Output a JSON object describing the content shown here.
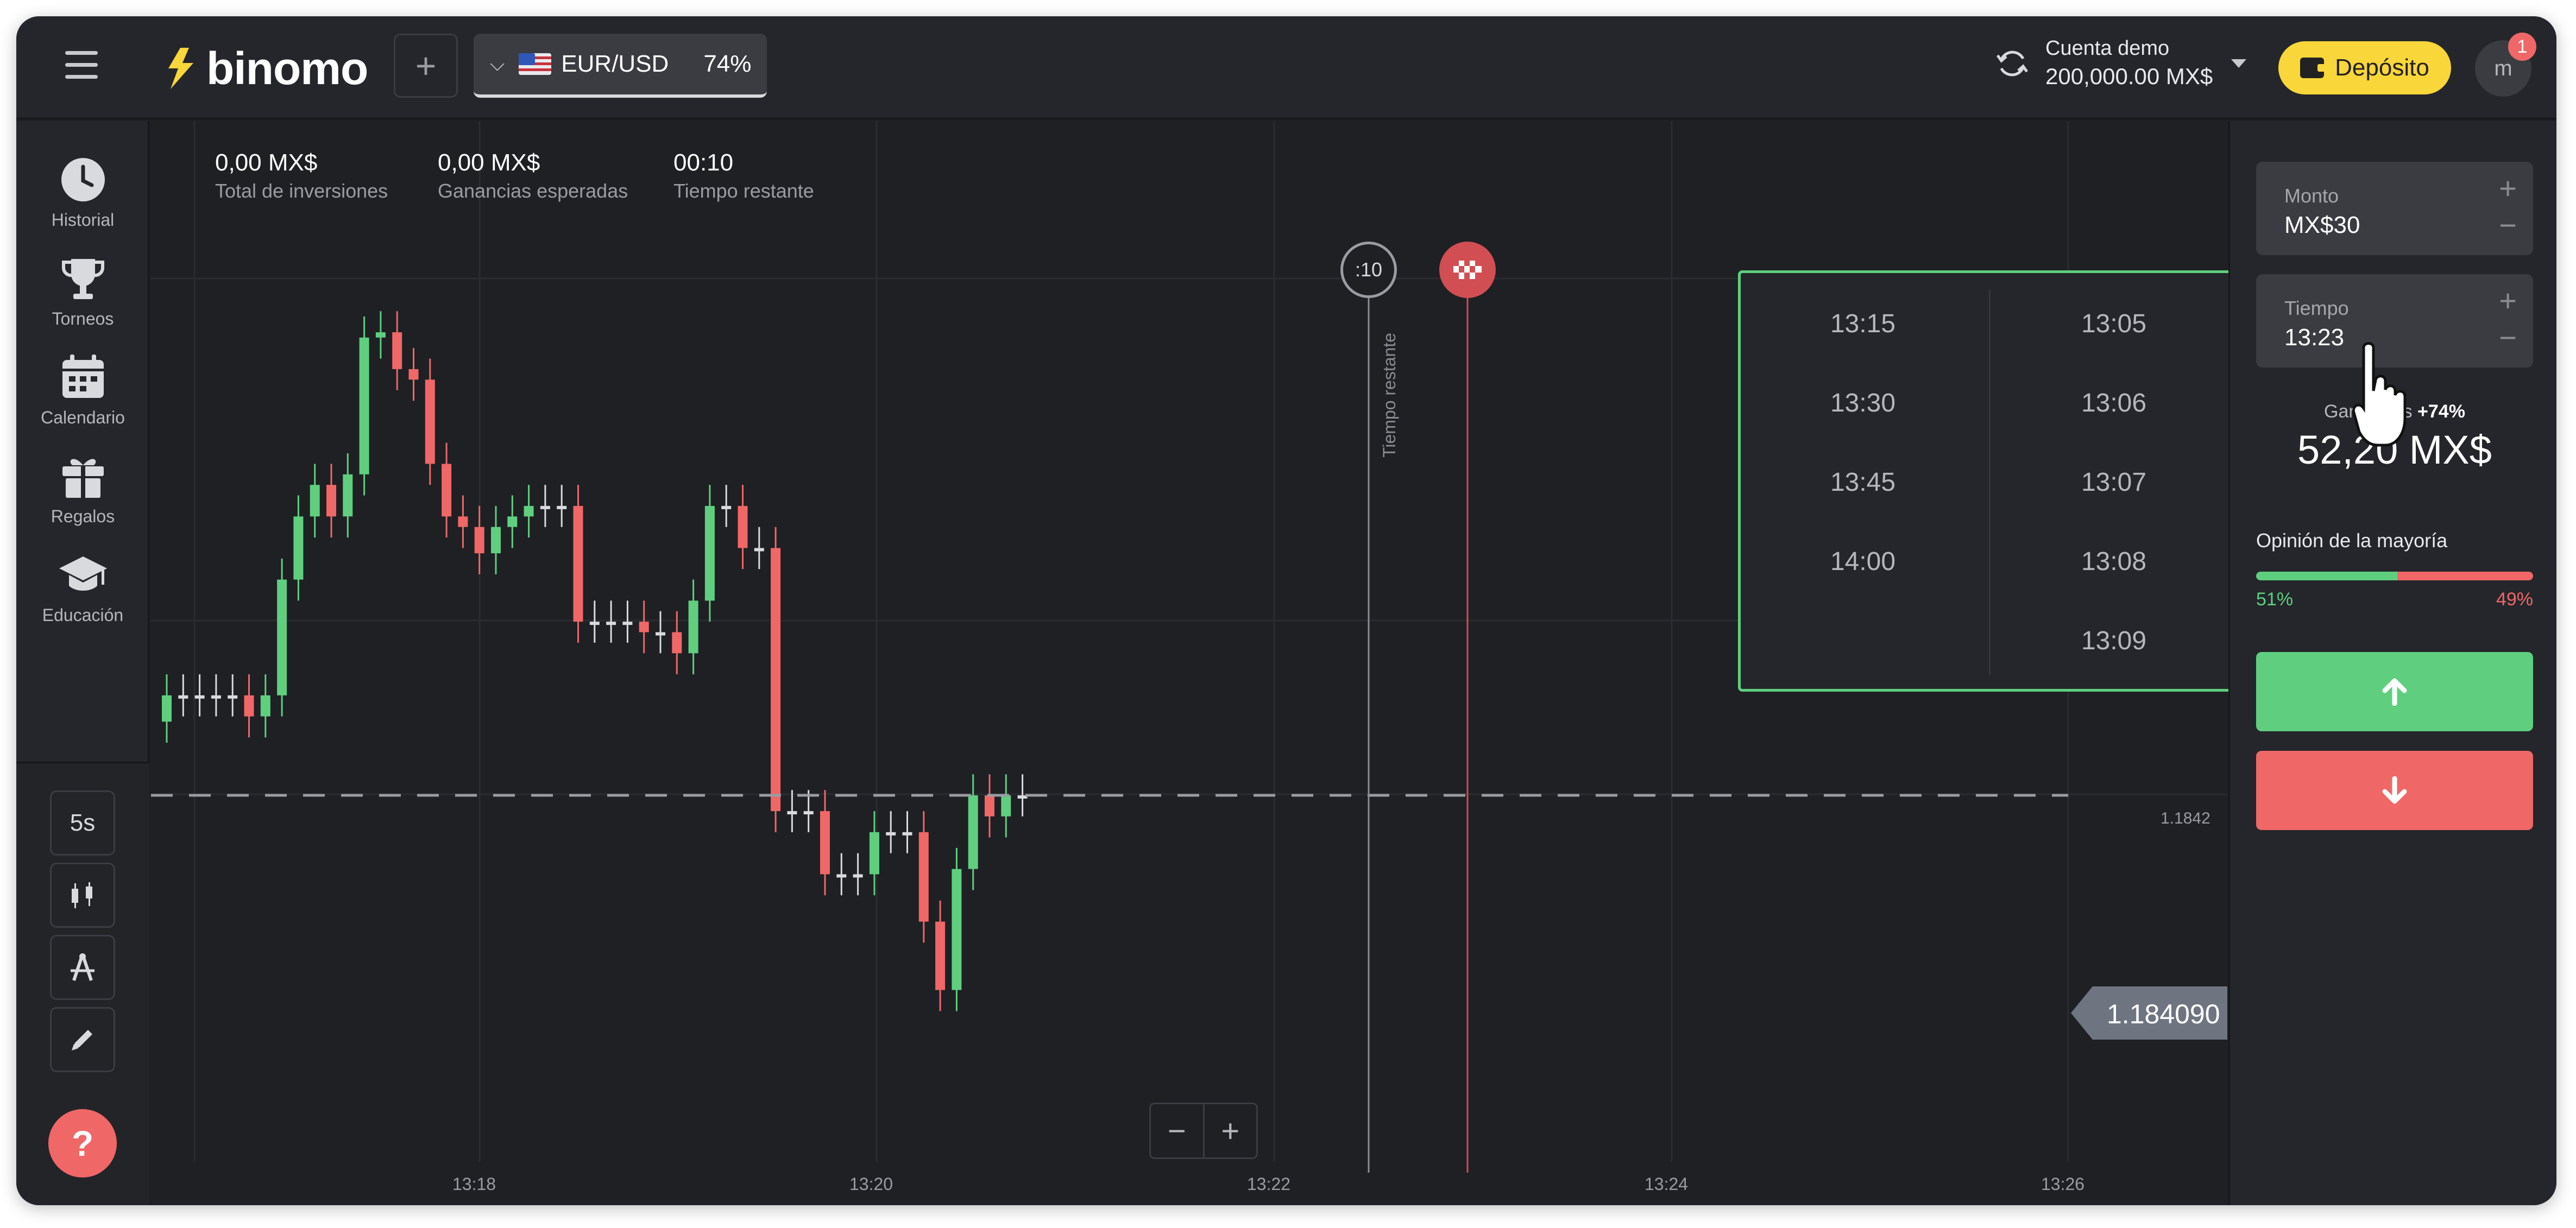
{
  "header": {
    "logo_text": "binomo",
    "add_tab_label": "+",
    "asset": {
      "name": "EUR/USD",
      "payout_percent": "74%"
    },
    "account": {
      "label": "Cuenta demo",
      "balance": "200,000.00 MX$"
    },
    "deposit_label": "Depósito",
    "avatar_initial": "m",
    "notification_count": "1"
  },
  "sidebar": {
    "items": [
      {
        "label": "Historial",
        "icon": "clock-icon"
      },
      {
        "label": "Torneos",
        "icon": "trophy-icon"
      },
      {
        "label": "Calendario",
        "icon": "calendar-icon"
      },
      {
        "label": "Regalos",
        "icon": "gift-icon"
      },
      {
        "label": "Educación",
        "icon": "graduation-cap-icon"
      }
    ],
    "tools": {
      "timeframe": "5s",
      "chart_type_icon": "candlestick-icon",
      "indicators_icon": "indicators-icon",
      "drawing_icon": "pencil-icon"
    },
    "help_label": "?"
  },
  "stats": [
    {
      "value": "0,00 MX$",
      "label": "Total de inversiones"
    },
    {
      "value": "0,00 MX$",
      "label": "Ganancias esperadas"
    },
    {
      "value": "00:10",
      "label": "Tiempo restante"
    }
  ],
  "chart": {
    "timer_badge": ":10",
    "remaining_label": "Tiempo restante",
    "current_price": "1.184090",
    "price_level_label": "1.1842",
    "x_ticks": [
      "13:18",
      "13:20",
      "13:22",
      "13:24",
      "13:26"
    ],
    "zoom_out_label": "−",
    "zoom_in_label": "+"
  },
  "time_dropdown": {
    "left_column": [
      "13:15",
      "13:30",
      "13:45",
      "14:00"
    ],
    "right_column": [
      "13:05",
      "13:06",
      "13:07",
      "13:08",
      "13:09"
    ]
  },
  "trade_panel": {
    "amount": {
      "label": "Monto",
      "value": "MX$30"
    },
    "time": {
      "label": "Tiempo",
      "value": "13:23"
    },
    "payout_label": "Ganancias",
    "payout_bonus": "+74%",
    "payout_value": "52,20 MX$",
    "majority_title": "Opinión de la mayoría",
    "majority_up": "51%",
    "majority_down": "49%",
    "majority_up_value": 51,
    "colors": {
      "up": "#5fcf7f",
      "down": "#f06767",
      "accent": "#f9d63a"
    }
  },
  "chart_data": {
    "type": "candlestick",
    "x": [
      "13:17.0",
      "13:17.1",
      "13:17.2",
      "13:17.3",
      "13:17.4",
      "13:17.5",
      "13:17.6",
      "13:17.7",
      "13:17.8",
      "13:17.9",
      "13:18.0",
      "13:18.1",
      "13:18.2",
      "13:18.3",
      "13:18.4",
      "13:18.5",
      "13:18.6",
      "13:18.7",
      "13:18.8",
      "13:18.9",
      "13:19.0",
      "13:19.1",
      "13:19.2",
      "13:19.3",
      "13:19.4",
      "13:19.5",
      "13:19.6",
      "13:19.7",
      "13:19.8",
      "13:19.9",
      "13:20.0",
      "13:20.1",
      "13:20.2",
      "13:20.3",
      "13:20.4",
      "13:20.5",
      "13:20.6",
      "13:20.7",
      "13:20.8",
      "13:20.9",
      "13:21.0",
      "13:21.1",
      "13:21.2",
      "13:21.3",
      "13:21.4",
      "13:21.5",
      "13:21.6",
      "13:21.7",
      "13:21.8",
      "13:21.9",
      "13:22.0",
      "13:22.1",
      "13:22.2"
    ],
    "open": [
      1.18423,
      1.18428,
      1.18428,
      1.18428,
      1.18428,
      1.18428,
      1.18424,
      1.18428,
      1.1845,
      1.18462,
      1.18468,
      1.18462,
      1.1847,
      1.18496,
      1.18497,
      1.1849,
      1.18488,
      1.18472,
      1.18462,
      1.1846,
      1.18455,
      1.1846,
      1.18462,
      1.18464,
      1.18464,
      1.18464,
      1.18442,
      1.18442,
      1.18442,
      1.18442,
      1.1844,
      1.1844,
      1.18436,
      1.18446,
      1.18464,
      1.18464,
      1.18456,
      1.18456,
      1.18406,
      1.18406,
      1.18406,
      1.18394,
      1.18394,
      1.18394,
      1.18402,
      1.18402,
      1.18402,
      1.18385,
      1.18372,
      1.18395,
      1.18409,
      1.18405,
      1.18409
    ],
    "close": [
      1.18428,
      1.18428,
      1.18428,
      1.18428,
      1.18428,
      1.18424,
      1.18428,
      1.1845,
      1.18462,
      1.18468,
      1.18462,
      1.1847,
      1.18496,
      1.18497,
      1.1849,
      1.18488,
      1.18472,
      1.18462,
      1.1846,
      1.18455,
      1.1846,
      1.18462,
      1.18464,
      1.18464,
      1.18464,
      1.18442,
      1.18442,
      1.18442,
      1.18442,
      1.1844,
      1.1844,
      1.18436,
      1.18446,
      1.18464,
      1.18464,
      1.18456,
      1.18456,
      1.18406,
      1.18406,
      1.18406,
      1.18394,
      1.18394,
      1.18394,
      1.18402,
      1.18402,
      1.18402,
      1.18385,
      1.18372,
      1.18395,
      1.18409,
      1.18405,
      1.18409,
      1.18409
    ],
    "ylabel": "",
    "xlabel": ""
  }
}
